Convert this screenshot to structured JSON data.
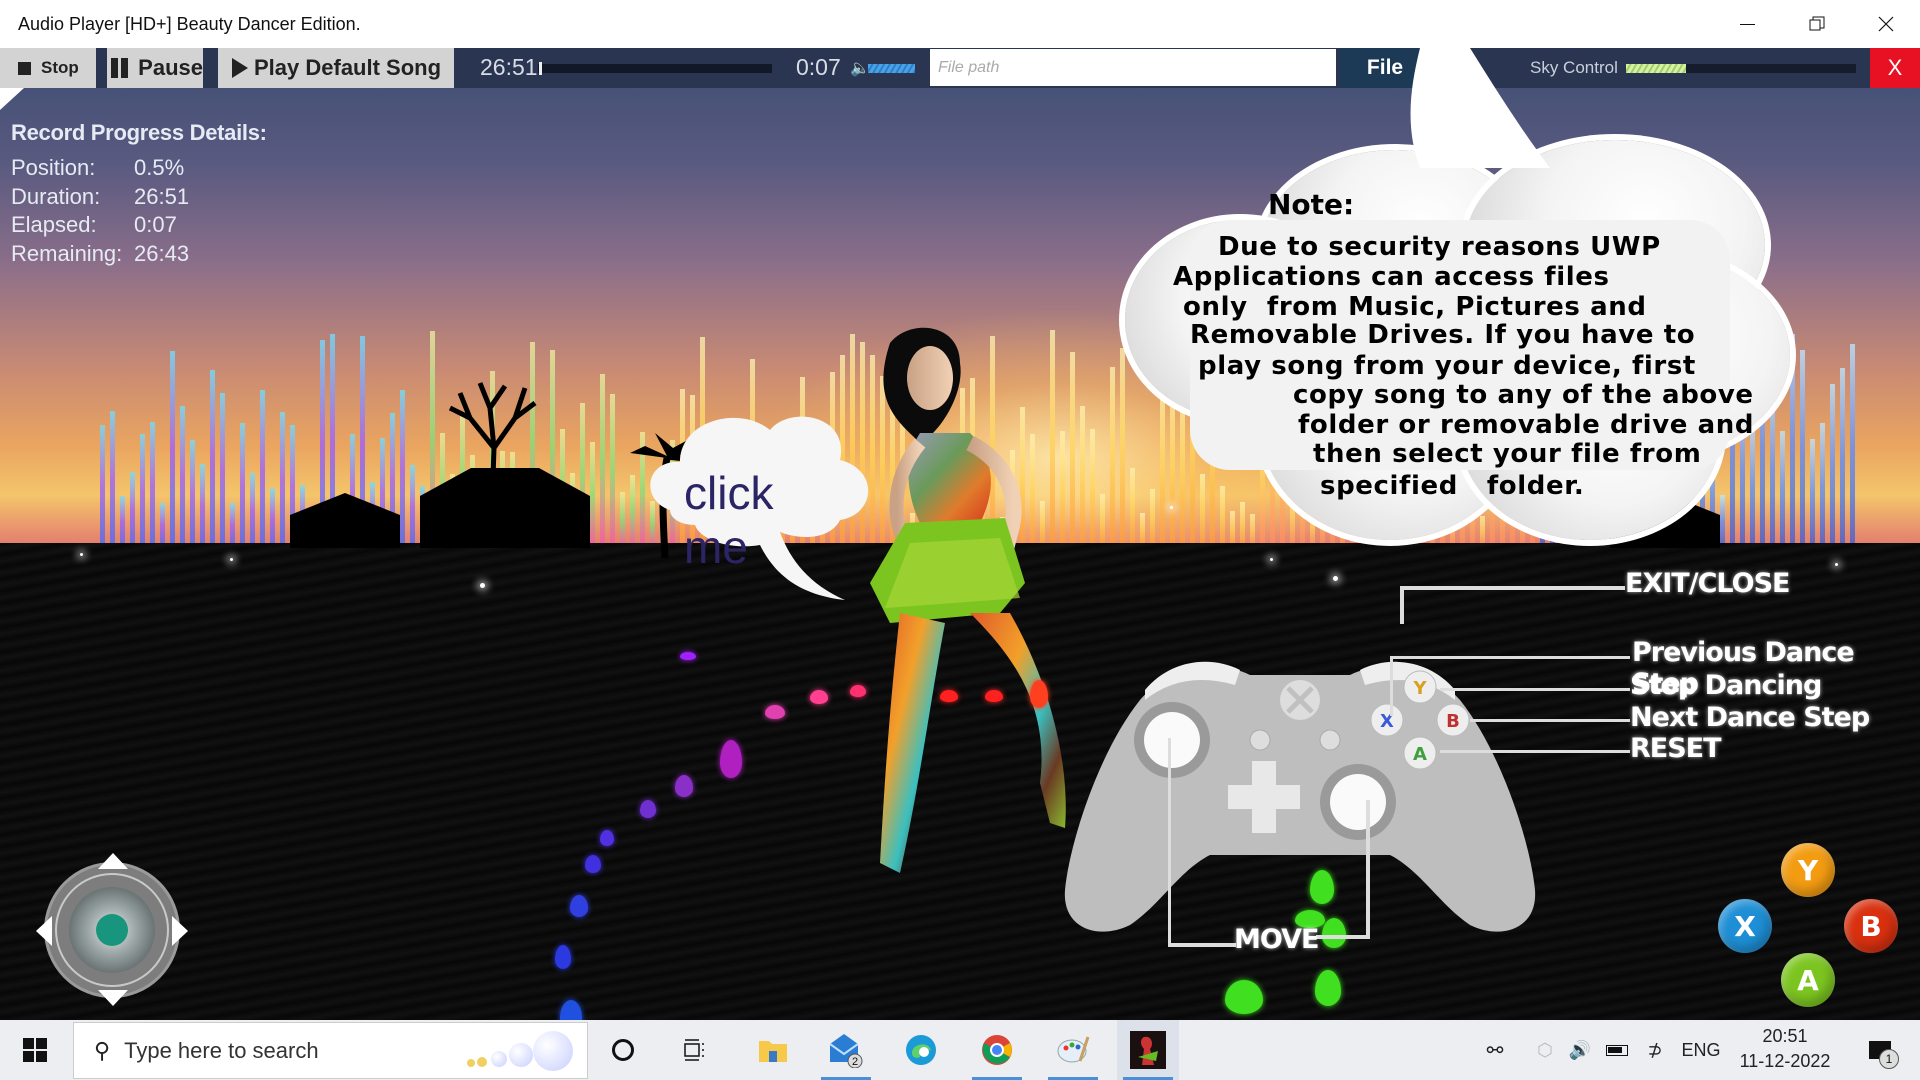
{
  "window": {
    "title": "Audio Player [HD+] Beauty Dancer Edition.",
    "minimize_icon": "minimize-icon",
    "restore_icon": "restore-icon",
    "close_icon": "close-icon"
  },
  "toolbar": {
    "stop_label": "Stop",
    "pause_label": "Pause",
    "play_default_label": "Play Default Song",
    "duration": "26:51",
    "elapsed": "0:07",
    "seek_progress_percent": 0.5,
    "volume_percent": 100,
    "file_path_placeholder": "File path",
    "file_path_value": "",
    "file_button_label": "File",
    "sky_control_label": "Sky Control",
    "sky_control_percent": 26,
    "exit_label": "X"
  },
  "progress_details": {
    "heading": "Record Progress Details:",
    "rows": [
      {
        "label": "Position:",
        "value": "0.5%"
      },
      {
        "label": "Duration:",
        "value": "26:51"
      },
      {
        "label": "Elapsed:",
        "value": "0:07"
      },
      {
        "label": "Remaining:",
        "value": "26:43"
      }
    ]
  },
  "note_bubble": {
    "title": "Note:",
    "lines": [
      "Due to security reasons UWP",
      "Applications can access files",
      "only  from Music, Pictures and",
      "Removable Drives. If you have to",
      "play song from your device, first",
      "copy song to any of the above",
      "folder or removable drive and",
      "then select your file from",
      "specified   folder."
    ]
  },
  "click_bubble": {
    "label": "click me"
  },
  "controller_legend": {
    "exit": "EXIT/CLOSE",
    "previous": "Previous Dance Step",
    "stop": "Stop Dancing",
    "next": "Next Dance Step",
    "reset": "RESET",
    "move": "MOVE",
    "buttons": {
      "y": "Y",
      "x": "X",
      "b": "B",
      "a": "A"
    }
  },
  "face_buttons": {
    "y": {
      "label": "Y",
      "color": "#f39c12"
    },
    "x": {
      "label": "X",
      "color": "#1e8fd6"
    },
    "b": {
      "label": "B",
      "color": "#d9300f"
    },
    "a": {
      "label": "A",
      "color": "#7cc520"
    }
  },
  "joystick": {
    "knob_color": "#17967d"
  },
  "taskbar": {
    "search_placeholder": "Type here to search",
    "apps": [
      {
        "name": "cortana",
        "icon": "cortana-circle-icon"
      },
      {
        "name": "task-view",
        "icon": "task-view-icon"
      },
      {
        "name": "file-explorer",
        "icon": "folder-icon"
      },
      {
        "name": "mail",
        "icon": "mail-icon",
        "badge": "2"
      },
      {
        "name": "edge",
        "icon": "edge-icon"
      },
      {
        "name": "chrome",
        "icon": "chrome-icon"
      },
      {
        "name": "paint",
        "icon": "paint-palette-icon"
      },
      {
        "name": "beauty-dancer",
        "icon": "app-dancer-icon"
      }
    ],
    "language": "ENG",
    "time": "20:51",
    "date": "11-12-2022",
    "notification_count": "1"
  }
}
